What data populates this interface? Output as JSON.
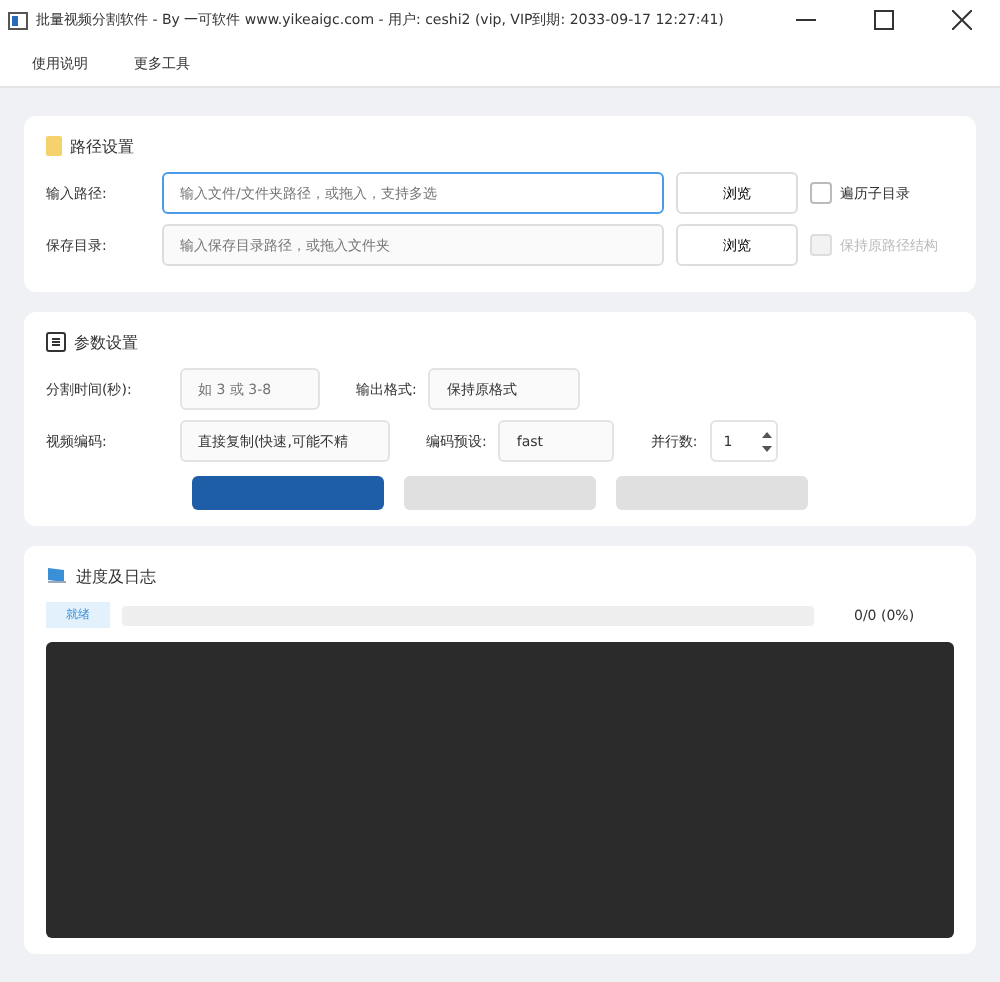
{
  "window": {
    "title": "批量视频分割软件  - By 一可软件 www.yikeaigc.com - 用户: ceshi2 (vip, VIP到期: 2033-09-17 12:27:41)"
  },
  "menu": [
    "使用说明",
    "更多工具"
  ],
  "path_settings": {
    "title": "路径设置",
    "input_path": {
      "label": "输入路径:",
      "placeholder": "输入文件/文件夹路径，或拖入，支持多选",
      "focused": true,
      "browse": "浏览",
      "option": {
        "label": "遍历子目录",
        "checked": false,
        "disabled": false
      }
    },
    "save_dir": {
      "label": "保存目录:",
      "placeholder": "输入保存目录路径，或拖入文件夹",
      "focused": false,
      "browse": "浏览",
      "option": {
        "label": "保持原路径结构",
        "checked": false,
        "disabled": true
      }
    }
  },
  "params": {
    "title": "参数设置",
    "split_time": {
      "label": "分割时间(秒):",
      "placeholder": "如 3 或 3-8"
    },
    "output_format": {
      "label": "输出格式:",
      "value": "保持原格式"
    },
    "video_codec": {
      "label": "视频编码:",
      "value": "直接复制(快速,可能不精"
    },
    "preset": {
      "label": "编码预设:",
      "value": "fast"
    },
    "parallel": {
      "label": "并行数:",
      "value": "1"
    },
    "buttons": [
      {
        "primary": true
      },
      {
        "primary": false
      },
      {
        "primary": false
      }
    ]
  },
  "progress": {
    "title": "进度及日志",
    "status": "就绪",
    "level": 0,
    "reading": "0/0 (0%)"
  }
}
